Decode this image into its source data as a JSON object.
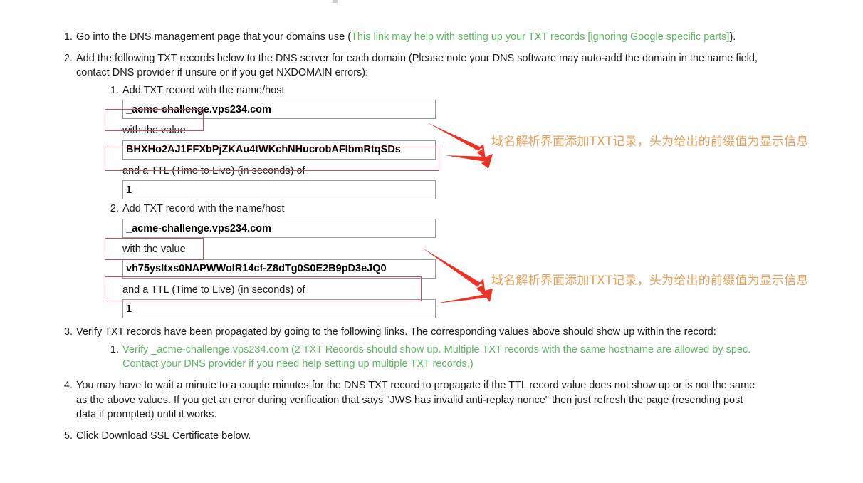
{
  "page": {
    "title_fragment_visible": "",
    "link_color": "#5cb860",
    "annotation_color": "#e8a15c",
    "highlight_box_color": "#c94f5e",
    "arrow_color": "#ee3124"
  },
  "steps": [
    {
      "number": "1.",
      "text_before": "Go into the DNS management page that your domains use (",
      "link_text": "This link may help with setting up your TXT records [ignoring Google specific parts]",
      "text_after": ")."
    },
    {
      "number": "2.",
      "text": "Add the following TXT records below to the DNS server for each domain (Please note your DNS software may auto-add the domain in the name field, contact DNS provider if unsure or if you get NXDOMAIN errors):"
    },
    {
      "number": "3.",
      "text": "Verify TXT records have been propagated by going to the following links. The corresponding values above should show up within the record:",
      "sub_link": "Verify _acme-challenge.vps234.com (2 TXT Records should show up. Multiple TXT records with the same hostname are allowed by spec. Contact your DNS provider if you need help setting up multiple TXT records.)"
    },
    {
      "number": "4.",
      "text": "You may have to wait a minute to a couple minutes for the DNS TXT record to propagate if the TTL record value does not show up or is not the same as the above values. If you get an error during verification that says \"JWS has invalid anti-replay nonce\" then just refresh the page (resending post data if prompted) until it works."
    },
    {
      "number": "5.",
      "text": "Click Download SSL Certificate below."
    }
  ],
  "records": [
    {
      "index": "1.",
      "name_label": "Add TXT record with the name/host",
      "name_value": "_acme-challenge.vps234.com",
      "name_prefix_highlight": "_acme-challenge",
      "value_label": "with the value",
      "value": "BHXHo2AJ1FFXbPjZKAu4tWKchNHucrobAFIbmRtqSDs",
      "ttl_label": "and a TTL (Time to Live) (in seconds) of",
      "ttl": "1",
      "annotation": "域名解析界面添加TXT记录，头为给出的前缀值为显示信息"
    },
    {
      "index": "2.",
      "name_label": "Add TXT record with the name/host",
      "name_value": "_acme-challenge.vps234.com",
      "name_prefix_highlight": "_acme-challenge",
      "value_label": "with the value",
      "value": "vh75ysItxs0NAPWWoIR14cf-Z8dTg0S0E2B9pD3eJQ0",
      "ttl_label": "and a TTL (Time to Live) (in seconds) of",
      "ttl": "1",
      "annotation": "域名解析界面添加TXT记录，头为给出的前缀值为显示信息"
    }
  ]
}
